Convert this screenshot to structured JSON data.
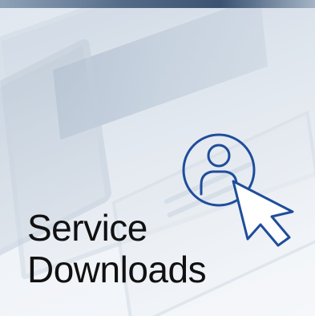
{
  "title": {
    "line1": "Service",
    "line2": "Downloads"
  },
  "icon": {
    "name": "user-cursor-icon",
    "stroke_color": "#1f4d9b"
  },
  "colors": {
    "text": "#111111",
    "accent": "#1f4d9b",
    "background": "#e8edf4"
  }
}
